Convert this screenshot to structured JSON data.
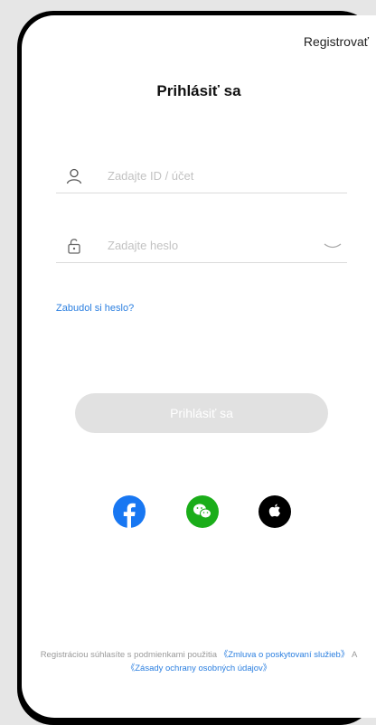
{
  "header": {
    "register_label": "Registrovať"
  },
  "page": {
    "title": "Prihlásiť sa"
  },
  "form": {
    "account_placeholder": "Zadajte ID / účet",
    "password_placeholder": "Zadajte heslo",
    "forgot_label": "Zabudol si heslo?",
    "login_button_label": "Prihlásiť sa"
  },
  "social": [
    {
      "icon": "facebook-icon"
    },
    {
      "icon": "wechat-icon"
    },
    {
      "icon": "apple-icon"
    }
  ],
  "terms": {
    "prefix": "Registráciou súhlasíte s podmienkami použitia ",
    "service_link": "《Zmluva o poskytovaní služieb》",
    "middle": " A ",
    "privacy_link": "《Zásady ochrany osobných údajov》"
  },
  "colors": {
    "accent": "#2b7fe0",
    "facebook": "#1877f2",
    "wechat": "#1aad19",
    "apple": "#000000",
    "button_disabled": "#e1e1e1"
  }
}
